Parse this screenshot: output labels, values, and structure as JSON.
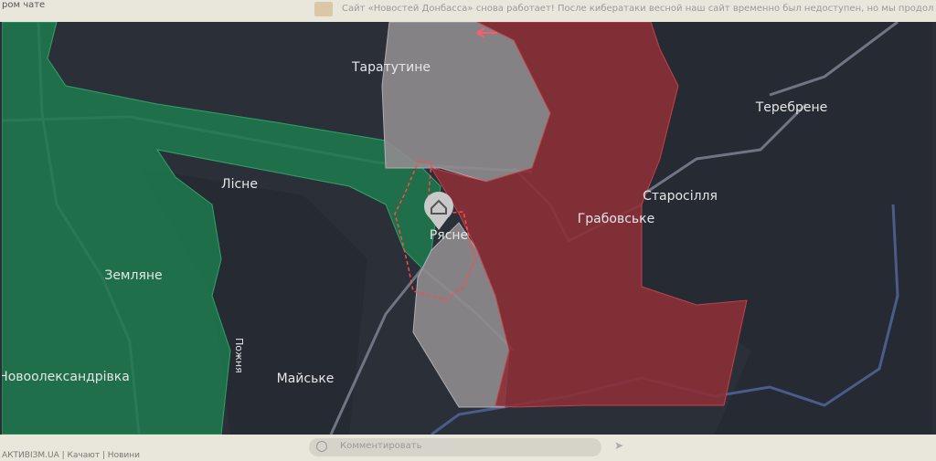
{
  "page": {
    "header_left_text": "ром чате",
    "header_news": "Сайт «Новостей Донбасса» снова работает! После кибератаки весной наш сайт временно был недоступен, но мы продолжали оставаться с",
    "footer_left_text": "АКТИВІЗМ.UA | Качают | Новини",
    "chat_placeholder": "Комментировать",
    "send_icon": "send-arrow-icon"
  },
  "map": {
    "colors": {
      "background": "#2b2f38",
      "ukraine_control": "#1f7a4f",
      "russia_control": "#8b3036",
      "contested": "#8f8c8f",
      "roads": "#6f7583",
      "river": "#4a5c8a",
      "label": "#e6e6e6",
      "dashed_outline": "#ff4a4a",
      "arrow": "#ff5b6b"
    },
    "places": [
      {
        "id": "taratutyne",
        "name": "Таратутине"
      },
      {
        "id": "terebrene",
        "name": "Теребрене"
      },
      {
        "id": "lisne",
        "name": "Лісне"
      },
      {
        "id": "starosillia",
        "name": "Старосілля"
      },
      {
        "id": "hrabovske",
        "name": "Грабовське"
      },
      {
        "id": "riasne",
        "name": "Рясне"
      },
      {
        "id": "zemliane",
        "name": "Земляне"
      },
      {
        "id": "novooleksandrivka",
        "name": "Новоолександрівка"
      },
      {
        "id": "maiske",
        "name": "Майське"
      },
      {
        "id": "pozhnia",
        "name": "Пожня"
      }
    ],
    "marker": {
      "place": "Рясне",
      "icon": "home-icon"
    }
  }
}
